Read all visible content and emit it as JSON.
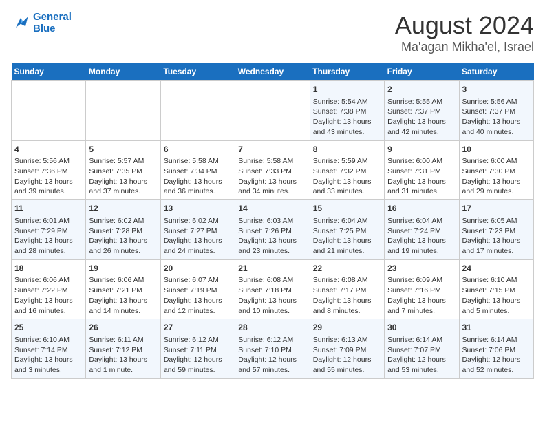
{
  "logo": {
    "line1": "General",
    "line2": "Blue"
  },
  "title": "August 2024",
  "subtitle": "Ma'agan Mikha'el, Israel",
  "weekdays": [
    "Sunday",
    "Monday",
    "Tuesday",
    "Wednesday",
    "Thursday",
    "Friday",
    "Saturday"
  ],
  "weeks": [
    [
      {
        "day": "",
        "info": ""
      },
      {
        "day": "",
        "info": ""
      },
      {
        "day": "",
        "info": ""
      },
      {
        "day": "",
        "info": ""
      },
      {
        "day": "1",
        "info": "Sunrise: 5:54 AM\nSunset: 7:38 PM\nDaylight: 13 hours\nand 43 minutes."
      },
      {
        "day": "2",
        "info": "Sunrise: 5:55 AM\nSunset: 7:37 PM\nDaylight: 13 hours\nand 42 minutes."
      },
      {
        "day": "3",
        "info": "Sunrise: 5:56 AM\nSunset: 7:37 PM\nDaylight: 13 hours\nand 40 minutes."
      }
    ],
    [
      {
        "day": "4",
        "info": "Sunrise: 5:56 AM\nSunset: 7:36 PM\nDaylight: 13 hours\nand 39 minutes."
      },
      {
        "day": "5",
        "info": "Sunrise: 5:57 AM\nSunset: 7:35 PM\nDaylight: 13 hours\nand 37 minutes."
      },
      {
        "day": "6",
        "info": "Sunrise: 5:58 AM\nSunset: 7:34 PM\nDaylight: 13 hours\nand 36 minutes."
      },
      {
        "day": "7",
        "info": "Sunrise: 5:58 AM\nSunset: 7:33 PM\nDaylight: 13 hours\nand 34 minutes."
      },
      {
        "day": "8",
        "info": "Sunrise: 5:59 AM\nSunset: 7:32 PM\nDaylight: 13 hours\nand 33 minutes."
      },
      {
        "day": "9",
        "info": "Sunrise: 6:00 AM\nSunset: 7:31 PM\nDaylight: 13 hours\nand 31 minutes."
      },
      {
        "day": "10",
        "info": "Sunrise: 6:00 AM\nSunset: 7:30 PM\nDaylight: 13 hours\nand 29 minutes."
      }
    ],
    [
      {
        "day": "11",
        "info": "Sunrise: 6:01 AM\nSunset: 7:29 PM\nDaylight: 13 hours\nand 28 minutes."
      },
      {
        "day": "12",
        "info": "Sunrise: 6:02 AM\nSunset: 7:28 PM\nDaylight: 13 hours\nand 26 minutes."
      },
      {
        "day": "13",
        "info": "Sunrise: 6:02 AM\nSunset: 7:27 PM\nDaylight: 13 hours\nand 24 minutes."
      },
      {
        "day": "14",
        "info": "Sunrise: 6:03 AM\nSunset: 7:26 PM\nDaylight: 13 hours\nand 23 minutes."
      },
      {
        "day": "15",
        "info": "Sunrise: 6:04 AM\nSunset: 7:25 PM\nDaylight: 13 hours\nand 21 minutes."
      },
      {
        "day": "16",
        "info": "Sunrise: 6:04 AM\nSunset: 7:24 PM\nDaylight: 13 hours\nand 19 minutes."
      },
      {
        "day": "17",
        "info": "Sunrise: 6:05 AM\nSunset: 7:23 PM\nDaylight: 13 hours\nand 17 minutes."
      }
    ],
    [
      {
        "day": "18",
        "info": "Sunrise: 6:06 AM\nSunset: 7:22 PM\nDaylight: 13 hours\nand 16 minutes."
      },
      {
        "day": "19",
        "info": "Sunrise: 6:06 AM\nSunset: 7:21 PM\nDaylight: 13 hours\nand 14 minutes."
      },
      {
        "day": "20",
        "info": "Sunrise: 6:07 AM\nSunset: 7:19 PM\nDaylight: 13 hours\nand 12 minutes."
      },
      {
        "day": "21",
        "info": "Sunrise: 6:08 AM\nSunset: 7:18 PM\nDaylight: 13 hours\nand 10 minutes."
      },
      {
        "day": "22",
        "info": "Sunrise: 6:08 AM\nSunset: 7:17 PM\nDaylight: 13 hours\nand 8 minutes."
      },
      {
        "day": "23",
        "info": "Sunrise: 6:09 AM\nSunset: 7:16 PM\nDaylight: 13 hours\nand 7 minutes."
      },
      {
        "day": "24",
        "info": "Sunrise: 6:10 AM\nSunset: 7:15 PM\nDaylight: 13 hours\nand 5 minutes."
      }
    ],
    [
      {
        "day": "25",
        "info": "Sunrise: 6:10 AM\nSunset: 7:14 PM\nDaylight: 13 hours\nand 3 minutes."
      },
      {
        "day": "26",
        "info": "Sunrise: 6:11 AM\nSunset: 7:12 PM\nDaylight: 13 hours\nand 1 minute."
      },
      {
        "day": "27",
        "info": "Sunrise: 6:12 AM\nSunset: 7:11 PM\nDaylight: 12 hours\nand 59 minutes."
      },
      {
        "day": "28",
        "info": "Sunrise: 6:12 AM\nSunset: 7:10 PM\nDaylight: 12 hours\nand 57 minutes."
      },
      {
        "day": "29",
        "info": "Sunrise: 6:13 AM\nSunset: 7:09 PM\nDaylight: 12 hours\nand 55 minutes."
      },
      {
        "day": "30",
        "info": "Sunrise: 6:14 AM\nSunset: 7:07 PM\nDaylight: 12 hours\nand 53 minutes."
      },
      {
        "day": "31",
        "info": "Sunrise: 6:14 AM\nSunset: 7:06 PM\nDaylight: 12 hours\nand 52 minutes."
      }
    ]
  ]
}
